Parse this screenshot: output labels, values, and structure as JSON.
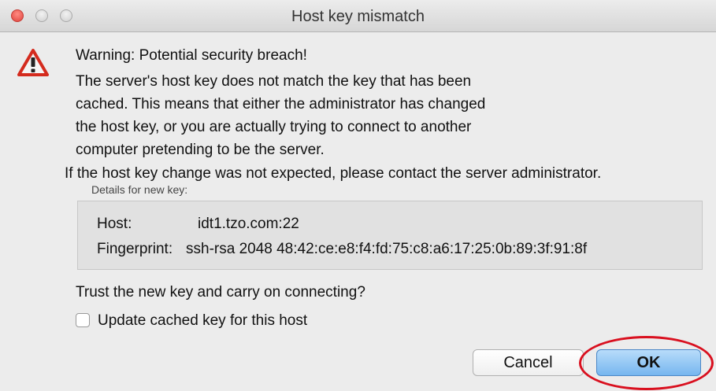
{
  "window": {
    "title": "Host key mismatch"
  },
  "icons": {
    "warning": "warning-triangle-icon"
  },
  "message": {
    "heading": "Warning: Potential security breach!",
    "paragraph_lines": [
      "The server's host key does not match the key that has been",
      "cached. This means that either the administrator has changed",
      "the host key, or you are actually trying to connect to another",
      "computer pretending to be the server."
    ],
    "contact": "If the host key change was not expected, please contact the server administrator."
  },
  "details": {
    "label": "Details for new key:",
    "host_label": "Host:",
    "host_value": "idt1.tzo.com:22",
    "fingerprint_label": "Fingerprint:",
    "fingerprint_value": "ssh-rsa 2048 48:42:ce:e8:f4:fd:75:c8:a6:17:25:0b:89:3f:91:8f"
  },
  "prompt": {
    "question": "Trust the new key and carry on connecting?",
    "checkbox_label": "Update cached key for this host",
    "checkbox_checked": false
  },
  "buttons": {
    "cancel": "Cancel",
    "ok": "OK"
  },
  "colors": {
    "warning_red": "#d42b1e",
    "ok_button_blue": "#76b6ef",
    "highlight_ring": "#d9101f"
  }
}
